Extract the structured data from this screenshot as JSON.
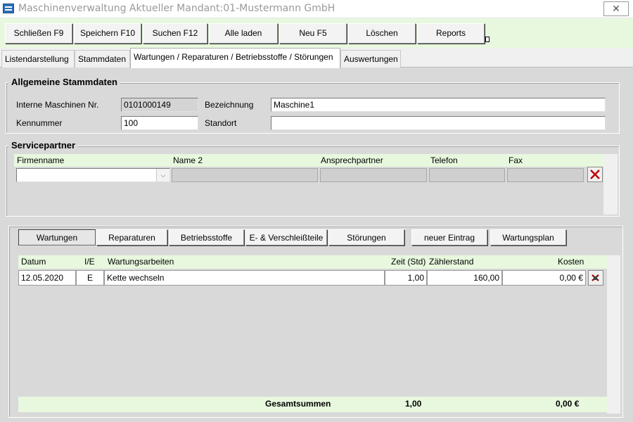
{
  "window": {
    "title": "Maschinenverwaltung Aktueller Mandant:01-Mustermann GmbH",
    "close_glyph": "✕"
  },
  "toolbar": {
    "buttons": [
      {
        "label": "Schließen F9"
      },
      {
        "label": "Speichern F10"
      },
      {
        "label": "Suchen F12"
      },
      {
        "label": "Alle laden"
      },
      {
        "label": "Neu F5"
      },
      {
        "label": "Löschen"
      },
      {
        "label": "Reports"
      }
    ]
  },
  "tabs": [
    {
      "label": "Listendarstellung"
    },
    {
      "label": "Stammdaten"
    },
    {
      "label": "Wartungen / Reparaturen / Betriebsstoffe / Störungen"
    },
    {
      "label": "Auswertungen"
    }
  ],
  "stammdaten": {
    "group_title": "Allgemeine Stammdaten",
    "interne_nr_label": "Interne Maschinen Nr.",
    "interne_nr_value": "0101000149",
    "bezeichnung_label": "Bezeichnung",
    "bezeichnung_value": "Maschine1",
    "kennummer_label": "Kennummer",
    "kennummer_value": "100",
    "standort_label": "Standort",
    "standort_value": ""
  },
  "servicepartner": {
    "group_title": "Servicepartner",
    "columns": [
      "Firmenname",
      "Name 2",
      "Ansprechpartner",
      "Telefon",
      "Fax"
    ]
  },
  "wartung": {
    "subtabs": [
      {
        "label": "Wartungen"
      },
      {
        "label": "Reparaturen"
      },
      {
        "label": "Betriebsstoffe"
      },
      {
        "label": "E- & Verschleißteile"
      },
      {
        "label": "Störungen"
      },
      {
        "label": "neuer Eintrag"
      },
      {
        "label": "Wartungsplan"
      }
    ],
    "columns": [
      "Datum",
      "I/E",
      "Wartungsarbeiten",
      "Zeit (Std)",
      "Zählerstand",
      "Kosten"
    ],
    "rows": [
      {
        "datum": "12.05.2020",
        "ie": "E",
        "arbeiten": "Kette wechseln",
        "zeit": "1,00",
        "zaehlerstand": "160,00",
        "kosten": "0,00 €"
      }
    ],
    "totals": {
      "label": "Gesamtsummen",
      "zeit": "1,00",
      "kosten": "0,00 €"
    }
  },
  "colors": {
    "accent_green": "#e7f8de",
    "panel_gray": "#d9d9d9",
    "delete_red": "#c00000"
  }
}
